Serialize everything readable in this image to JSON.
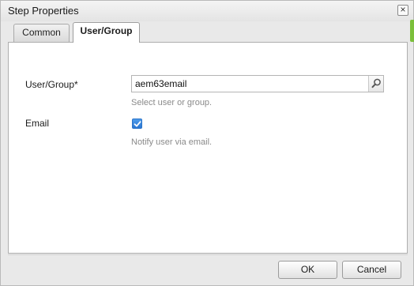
{
  "dialog": {
    "title": "Step Properties",
    "close_label": "×"
  },
  "tabs": [
    {
      "label": "Common",
      "active": false
    },
    {
      "label": "User/Group",
      "active": true
    }
  ],
  "form": {
    "user_group": {
      "label": "User/Group",
      "required_mark": "*",
      "value": "aem63email",
      "hint": "Select user or group."
    },
    "email": {
      "label": "Email",
      "checked": true,
      "hint": "Notify user via email."
    }
  },
  "footer": {
    "ok_label": "OK",
    "cancel_label": "Cancel"
  },
  "icons": {
    "search": "search-icon",
    "checkmark": "checkmark-icon",
    "close": "close-icon"
  },
  "colors": {
    "accent_green": "#7bbf3a",
    "checkbox_blue": "#2a76d2"
  }
}
